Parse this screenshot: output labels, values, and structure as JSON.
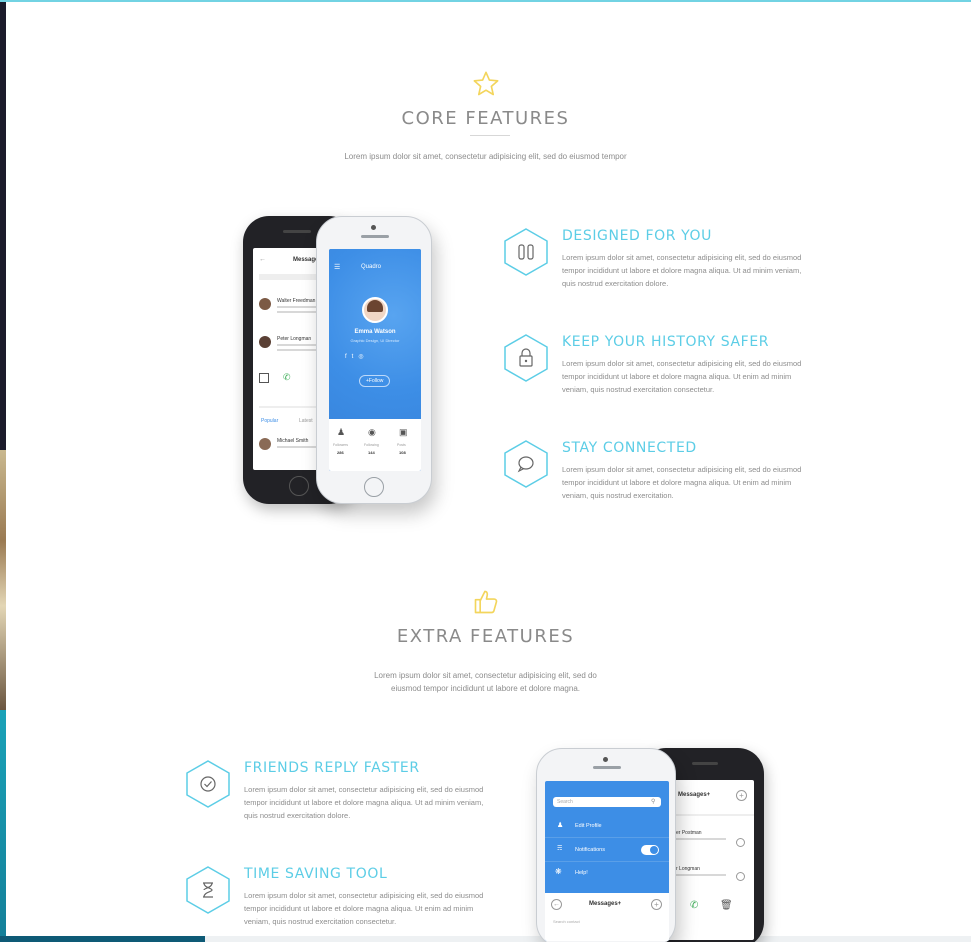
{
  "core": {
    "icon": "star-icon",
    "title": "CORE FEATURES",
    "subtitle": "Lorem ipsum dolor sit amet, consectetur adipisicing elit,  sed do eiusmod tempor",
    "features": [
      {
        "icon": "phone-chip-icon",
        "title": "DESIGNED FOR YOU",
        "body": "Lorem ipsum dolor sit amet, consectetur adipisicing elit, sed do eiusmod tempor incididunt ut labore et dolore magna aliqua. Ut ad minim veniam, quis nostrud exercitation dolore."
      },
      {
        "icon": "lock-icon",
        "title": "KEEP YOUR HISTORY SAFER",
        "body": "Lorem ipsum dolor sit amet, consectetur adipisicing elit, sed do eiusmod tempor incididunt ut labore et dolore magna aliqua. Ut enim ad minim veniam, quis nostrud exercitation consectetur."
      },
      {
        "icon": "chat-bubble-icon",
        "title": "STAY CONNECTED",
        "body": "Lorem ipsum dolor sit amet, consectetur adipisicing elit, sed do eiusmod tempor incididunt ut labore et dolore magna aliqua. Ut enim ad minim veniam, quis nostrud exercitation."
      }
    ],
    "mockup": {
      "back_title": "Messages+",
      "back_contacts": [
        "Walter Freedman",
        "Peter Longman"
      ],
      "back_tabs": [
        "Popular",
        "Latest"
      ],
      "back_bottom_contact": "Michael Smith",
      "front_app": "Quadro",
      "profile_name": "Emma Watson",
      "profile_role": "Graphic Design, UI Director",
      "follow_label": "+Follow",
      "stats": [
        {
          "label": "Followers",
          "value": "286"
        },
        {
          "label": "Following",
          "value": "144"
        },
        {
          "label": "Posts",
          "value": "108"
        }
      ]
    }
  },
  "extra": {
    "icon": "thumbs-up-icon",
    "title": "EXTRA FEATURES",
    "subtitle_line1": "Lorem ipsum dolor sit amet, consectetur adipisicing elit, sed do",
    "subtitle_line2": "eiusmod tempor incididunt ut labore et dolore magna.",
    "features": [
      {
        "icon": "check-circle-icon",
        "title": "FRIENDS REPLY FASTER",
        "body": "Lorem ipsum dolor sit amet, consectetur adipisicing elit, sed do eiusmod tempor incididunt ut labore et dolore magna aliqua. Ut ad minim veniam, quis nostrud exercitation dolore."
      },
      {
        "icon": "hourglass-icon",
        "title": "TIME SAVING TOOL",
        "body": "Lorem ipsum dolor sit amet, consectetur adipisicing elit, sed do eiusmod tempor incididunt ut labore et dolore magna aliqua. Ut enim ad minim veniam, quis nostrud exercitation consectetur."
      }
    ],
    "mockup": {
      "search_placeholder": "Search",
      "menu": [
        "Edit Profile",
        "Notifications",
        "Help!"
      ],
      "panel_title": "Messages+",
      "panel_search": "Search contact",
      "back_title": "Messages+",
      "back_contacts": [
        "er Postman",
        "r Longman"
      ]
    }
  },
  "colors": {
    "accent": "#5ccde6",
    "icon_yellow": "#f3d55c",
    "app_blue": "#3d8ee6",
    "title_gray": "#8a8a8a"
  }
}
